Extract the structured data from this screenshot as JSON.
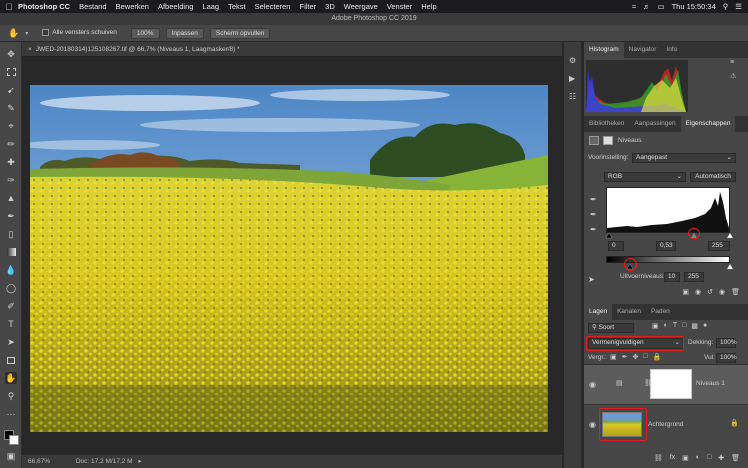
{
  "menubar": {
    "apple": "",
    "items": [
      "Photoshop CC",
      "Bestand",
      "Bewerken",
      "Afbeelding",
      "Laag",
      "Tekst",
      "Selecteren",
      "Filter",
      "3D",
      "Weergave",
      "Venster",
      "Help"
    ],
    "clock": "Thu 15:50:34"
  },
  "window_title": "Adobe Photoshop CC 2019",
  "options": {
    "scroll_all": "Alle vensters schuiven",
    "zoom": "100%",
    "fit": "Inpassen",
    "fill": "Scherm opvullen"
  },
  "document": {
    "tab": "JWED-20180314)125108267.tif @ 66,7% (Niveaus 1, Laagmasker/8) *",
    "zoom": "66,67%",
    "doc_info": "Doc: 17,2 M/17,2 M"
  },
  "top_panel": {
    "tabs": [
      "Histogram",
      "Navigator",
      "Info"
    ]
  },
  "props_panel": {
    "tabs": [
      "Bibliotheken",
      "Aanpassingen",
      "Eigenschappen"
    ],
    "title": "Niveaus",
    "preset_label": "Voorinstelling:",
    "preset_value": "Aangepast",
    "channel": "RGB",
    "auto": "Automatisch",
    "input_shadow": "0",
    "input_mid": "0,53",
    "input_high": "255",
    "output_label": "Uitvoerniveaus:",
    "output_low": "10",
    "output_high": "255"
  },
  "layers_panel": {
    "tabs": [
      "Lagen",
      "Kanalen",
      "Paden"
    ],
    "kind": "Soort",
    "blend_mode": "Vermenigvuldigen",
    "opacity_label": "Dekking:",
    "opacity": "100%",
    "lock_label": "Vergr.:",
    "fill_label": "Vul:",
    "fill": "100%",
    "layers": [
      {
        "name": "Niveaus 1"
      },
      {
        "name": "Achtergrond"
      }
    ]
  },
  "colors": {
    "accent_red": "#e02020",
    "panel_bg": "#474747",
    "canvas_bg": "#282828"
  }
}
